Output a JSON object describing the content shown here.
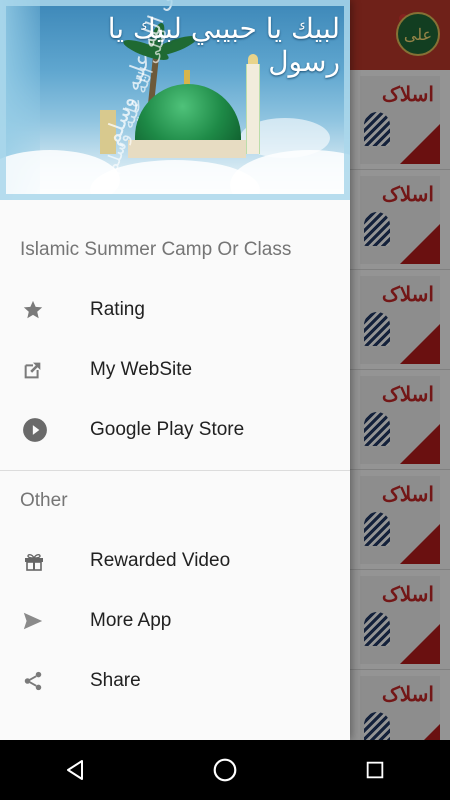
{
  "drawer": {
    "header_calligraphy": "لبيك يا حبيبي لبيك يا رسول",
    "header_side_text": "صلى الله عليه وسلم",
    "app_title": "Islamic Summer Camp Or Class",
    "section_other": "Other",
    "items_main": [
      {
        "label": "Rating",
        "icon": "star-icon"
      },
      {
        "label": "My WebSite",
        "icon": "external-link-icon"
      },
      {
        "label": "Google Play Store",
        "icon": "play-circle-icon"
      }
    ],
    "items_other": [
      {
        "label": "Rewarded Video",
        "icon": "gift-icon"
      },
      {
        "label": "More App",
        "icon": "send-icon"
      },
      {
        "label": "Share",
        "icon": "share-icon"
      }
    ]
  },
  "app_background": {
    "toolbar_color": "#c0392b",
    "logo_text": "علی",
    "list_thumb_text": "اسلاک"
  },
  "colors": {
    "drawer_bg": "#fafafa",
    "text_primary": "#212121",
    "text_secondary": "#757575",
    "icon_color": "#7a7a7a"
  },
  "navbar": {
    "buttons": [
      "back-icon",
      "home-icon",
      "recents-icon"
    ]
  }
}
